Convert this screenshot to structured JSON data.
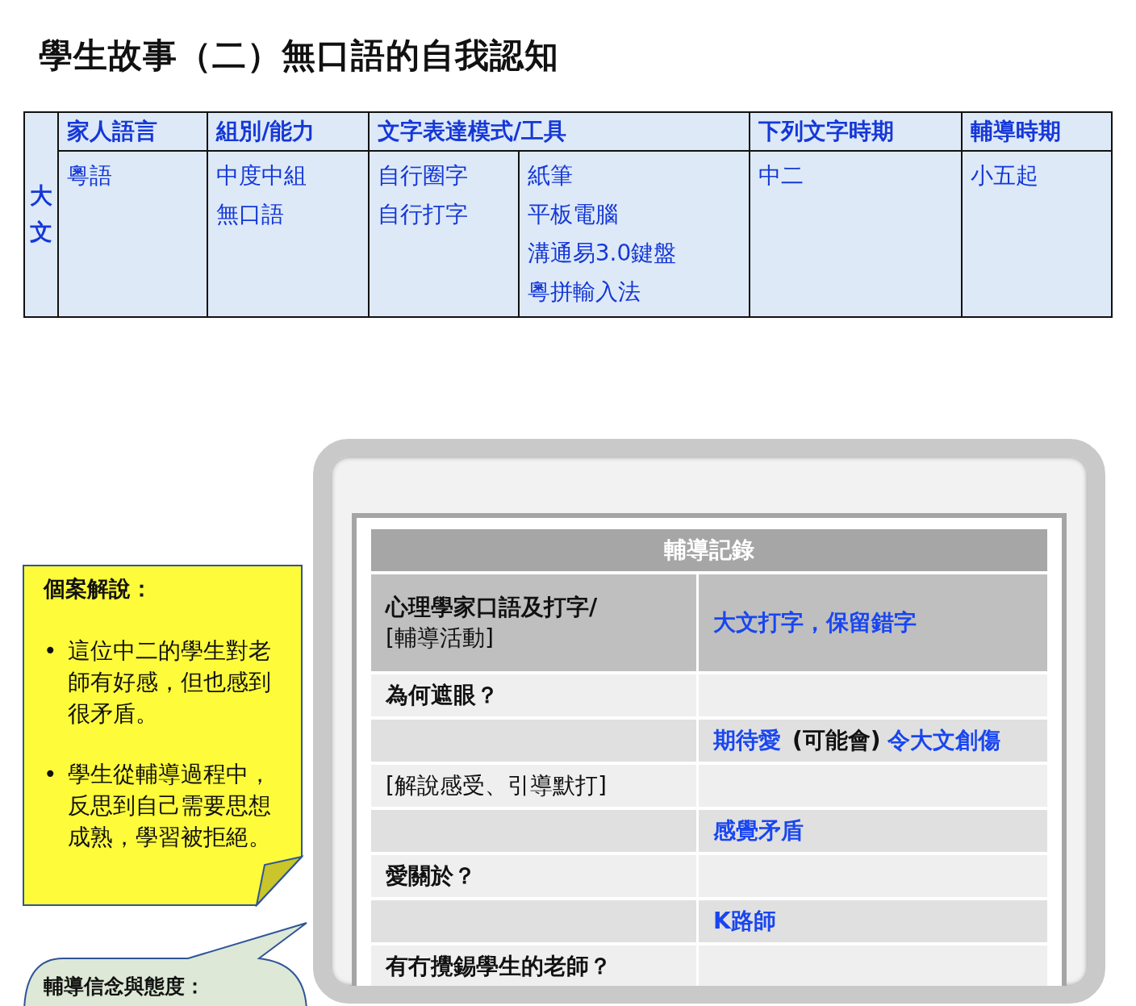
{
  "title": "學生故事（二）無口語的自我認知",
  "profile": {
    "student": "大文",
    "columns": [
      {
        "heading": "家人語言",
        "cells": [
          [
            "粵語"
          ]
        ]
      },
      {
        "heading": "組別/能力",
        "cells": [
          [
            "中度中組",
            "無口語"
          ]
        ]
      },
      {
        "heading": "文字表達模式/工具",
        "cells": [
          [
            "自行圈字",
            "自行打字"
          ],
          [
            "紙筆",
            "平板電腦",
            "溝通易3.0鍵盤",
            "粵拼輸入法"
          ]
        ]
      },
      {
        "heading": "下列文字時期",
        "cells": [
          [
            "中二"
          ]
        ]
      },
      {
        "heading": "輔導時期",
        "cells": [
          [
            "小五起"
          ]
        ]
      }
    ]
  },
  "case_note": {
    "heading": "個案解說：",
    "points": [
      {
        "marker": "•",
        "text": "這位中二的學生對老師有好感，但也感到很矛盾。"
      },
      {
        "marker": "•",
        "text": "學生從輔導過程中，反思到自己需要思想成熟，學習被拒絕。"
      }
    ]
  },
  "bubble": {
    "heading": "輔導信念與態度："
  },
  "record": {
    "title": "輔導記錄",
    "header": {
      "left": [
        {
          "text": "心理學家口語及打字/",
          "kind": "question"
        },
        {
          "text": "[輔導活動]",
          "kind": "activity"
        }
      ],
      "right": [
        {
          "text": "大文打字，保留錯字",
          "kind": "key"
        }
      ]
    },
    "rows": [
      {
        "left": [
          {
            "text": "為何遮眼？",
            "kind": "question"
          }
        ],
        "right": []
      },
      {
        "left": [],
        "right": [
          {
            "text": "期待愛",
            "kind": "key"
          },
          {
            "text": "(可能會)",
            "kind": "note"
          },
          {
            "text": "令大文創傷",
            "kind": "key"
          }
        ]
      },
      {
        "left": [
          {
            "text": "[解說感受、引導默打]",
            "kind": "activity"
          }
        ],
        "right": []
      },
      {
        "left": [],
        "right": [
          {
            "text": "感覺矛盾",
            "kind": "key"
          }
        ]
      },
      {
        "left": [
          {
            "text": "愛關於？",
            "kind": "question"
          }
        ],
        "right": []
      },
      {
        "left": [],
        "right": [
          {
            "text": "K路師",
            "kind": "key"
          }
        ]
      },
      {
        "left": [
          {
            "text": "有冇攪錫學生的老師？",
            "kind": "question"
          }
        ],
        "right": []
      }
    ]
  }
}
